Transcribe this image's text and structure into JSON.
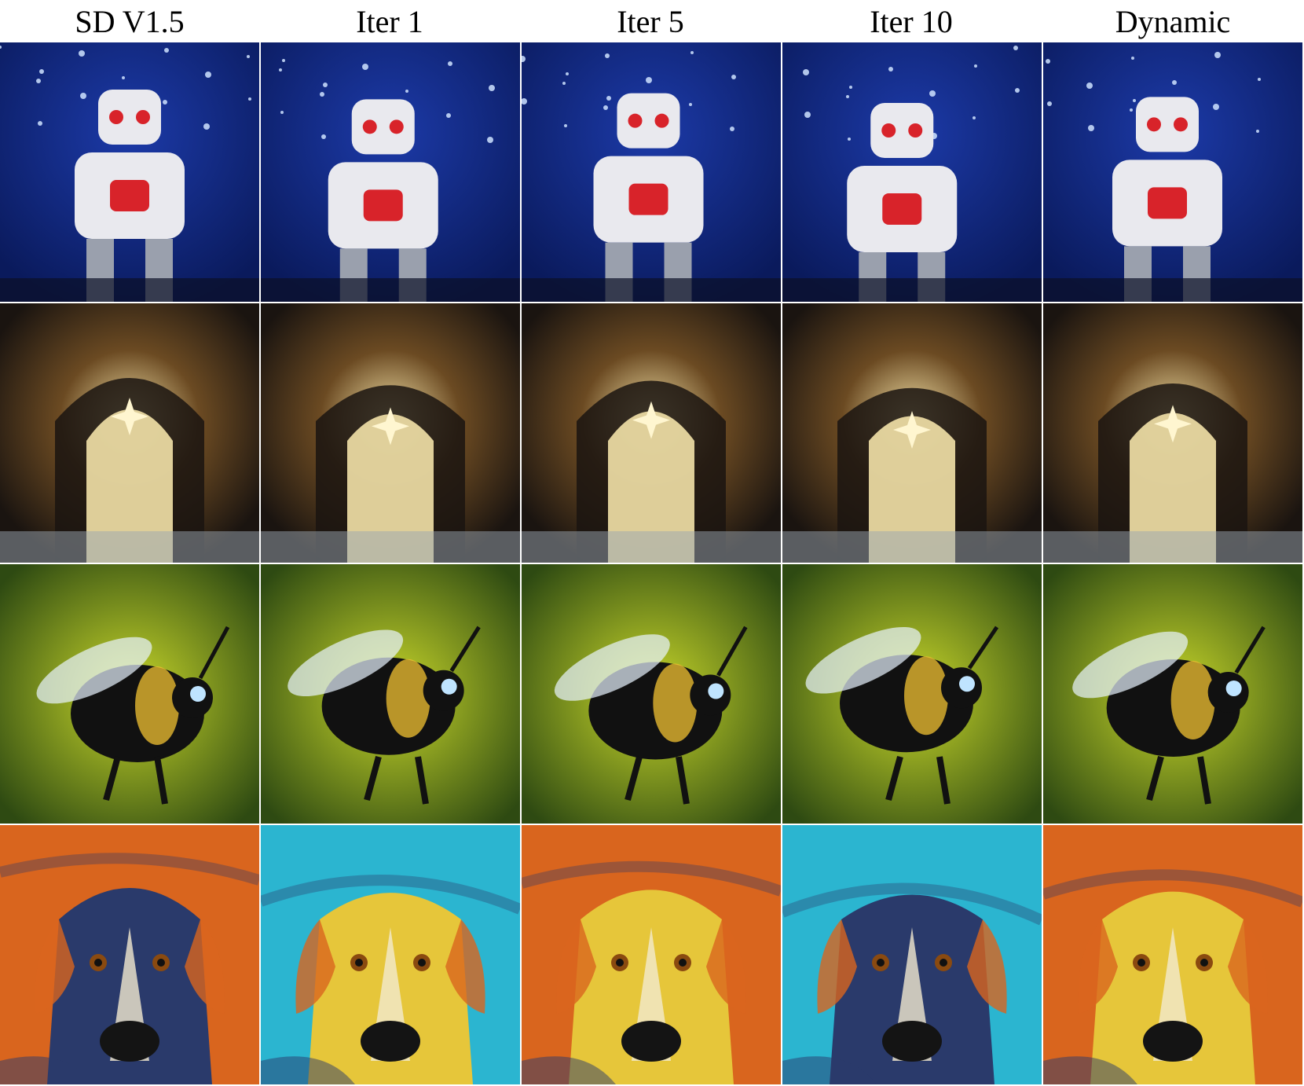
{
  "columns": [
    "SD V1.5",
    "Iter 1",
    "Iter 5",
    "Iter 10",
    "Dynamic"
  ],
  "rows": [
    {
      "subject": "robot",
      "icon": "robot-icon"
    },
    {
      "subject": "gate",
      "icon": "gate-icon"
    },
    {
      "subject": "bee",
      "icon": "bee-icon"
    },
    {
      "subject": "dog",
      "icon": "dog-icon"
    }
  ],
  "palettes": {
    "robot": [
      "#0a1a5c",
      "#1c3aa8",
      "#e9e9ee",
      "#d8232a"
    ],
    "gate": [
      "#1a1410",
      "#6b4a22",
      "#f3e2a8",
      "#9aa6b2"
    ],
    "bee": [
      "#2e4a12",
      "#c9d82a",
      "#111111",
      "#f1c232"
    ],
    "dog": [
      "#d9651e",
      "#2bb5d0",
      "#e6c63a",
      "#2a3a6b"
    ]
  }
}
